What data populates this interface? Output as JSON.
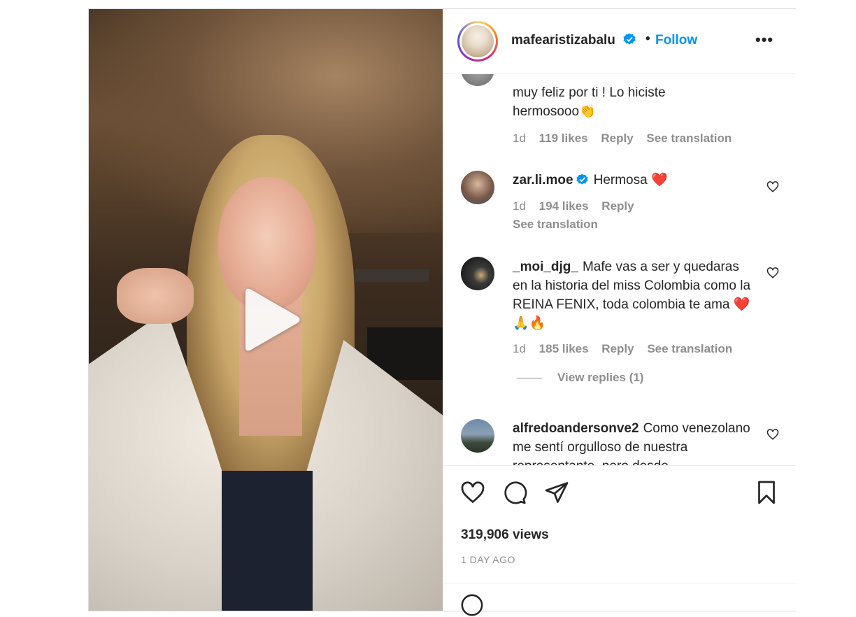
{
  "header": {
    "username": "mafearistizabalu",
    "separator": "•",
    "follow_label": "Follow",
    "more_label": "•••"
  },
  "comments": [
    {
      "text": "muy feliz por ti ! Lo hiciste hermosooo",
      "emoji": "👏",
      "time": "1d",
      "likes": "119 likes",
      "reply": "Reply",
      "see_translation": "See translation"
    },
    {
      "username": "zar.li.moe",
      "text": "Hermosa",
      "emoji": "❤️",
      "time": "1d",
      "likes": "194 likes",
      "reply": "Reply",
      "see_translation": "See translation"
    },
    {
      "username": "_moi_djg_",
      "text": "Mafe vas a ser y quedaras en la historia del miss Colombia como la REINA FENIX, toda colombia te ama",
      "emoji": "❤️🙏🔥",
      "time": "1d",
      "likes": "185 likes",
      "reply": "Reply",
      "see_translation": "See translation",
      "view_replies": "View replies (1)"
    },
    {
      "username": "alfredoandersonve2",
      "text": "Como venezolano me sentí orgulloso de nuestra representante, pero desde"
    }
  ],
  "stats": {
    "views": "319,906 views",
    "posted": "1 DAY AGO"
  },
  "colors": {
    "accent": "#0095f6",
    "muted": "#8e8e8e",
    "text": "#262626"
  },
  "icons": [
    "heart-icon",
    "comment-icon",
    "share-icon",
    "bookmark-icon",
    "play-icon",
    "verified-icon",
    "more-icon"
  ]
}
